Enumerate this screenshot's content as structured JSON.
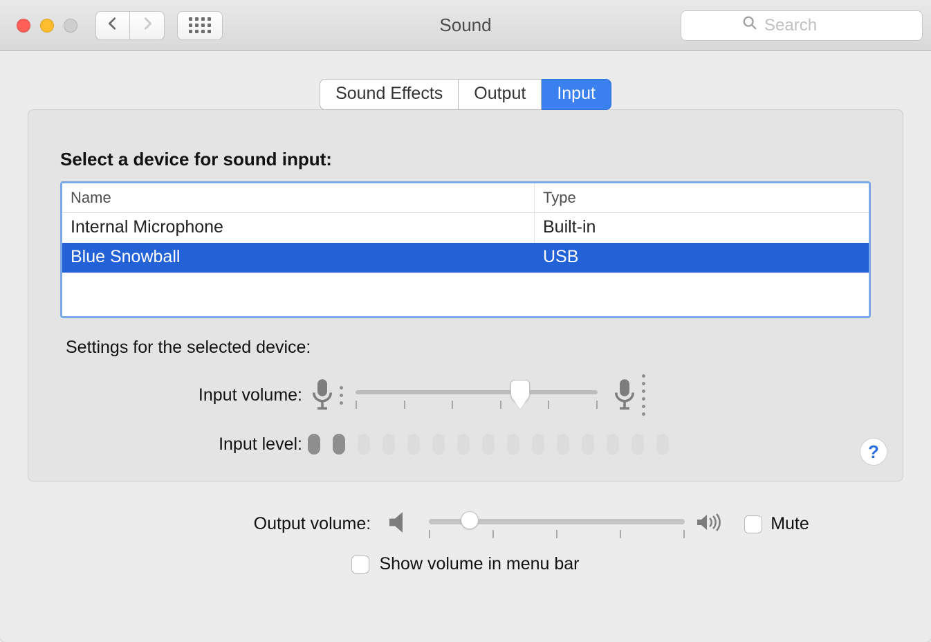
{
  "window": {
    "title": "Sound"
  },
  "toolbar": {
    "search_placeholder": "Search"
  },
  "tabs": [
    {
      "label": "Sound Effects",
      "active": false
    },
    {
      "label": "Output",
      "active": false
    },
    {
      "label": "Input",
      "active": true
    }
  ],
  "input_panel": {
    "select_label": "Select a device for sound input:",
    "columns": {
      "name": "Name",
      "type": "Type"
    },
    "devices": [
      {
        "name": "Internal Microphone",
        "type": "Built-in",
        "selected": false
      },
      {
        "name": "Blue Snowball",
        "type": "USB",
        "selected": true
      }
    ],
    "settings_label": "Settings for the selected device:",
    "input_volume_label": "Input volume:",
    "input_volume_percent": 68,
    "input_level_label": "Input level:",
    "input_level_segments_total": 15,
    "input_level_segments_on": 2
  },
  "footer": {
    "output_volume_label": "Output volume:",
    "output_volume_percent": 16,
    "mute_label": "Mute",
    "mute_checked": false,
    "show_in_menu_bar_label": "Show volume in menu bar",
    "show_in_menu_bar_checked": false
  },
  "help_label": "?"
}
